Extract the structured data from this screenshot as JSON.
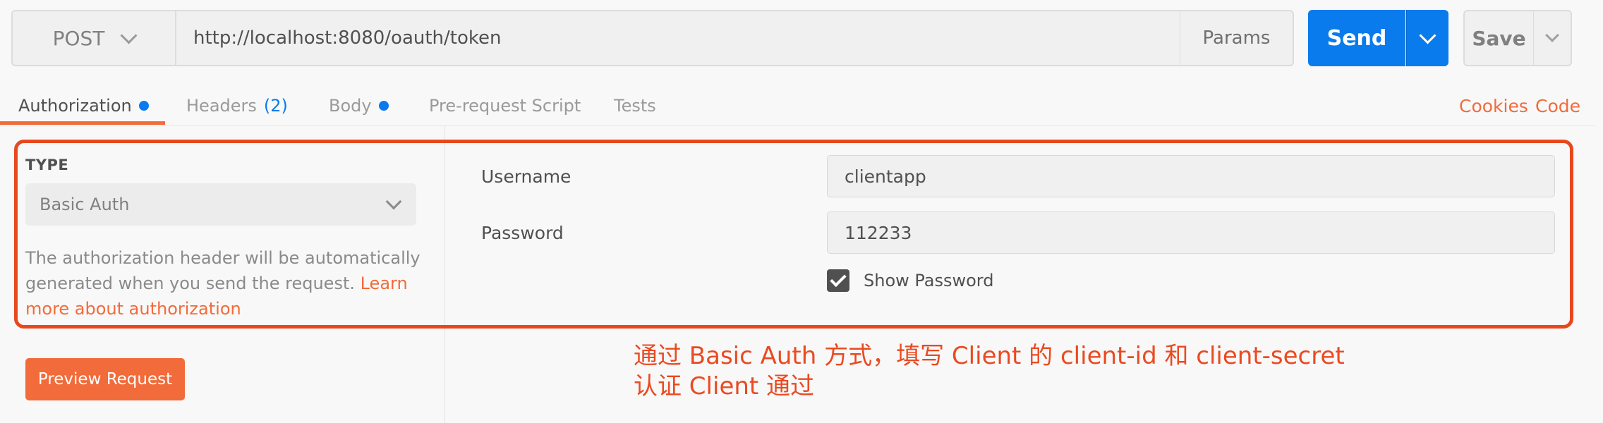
{
  "request": {
    "method": "POST",
    "url": "http://localhost:8080/oauth/token",
    "params_label": "Params",
    "send_label": "Send",
    "save_label": "Save"
  },
  "tabs": [
    {
      "label": "Authorization",
      "active": true,
      "dot": true
    },
    {
      "label": "Headers",
      "count": "(2)"
    },
    {
      "label": "Body",
      "dot": true
    },
    {
      "label": "Pre-request Script"
    },
    {
      "label": "Tests"
    }
  ],
  "links": {
    "cookies": "Cookies",
    "code": "Code"
  },
  "auth": {
    "type_label": "TYPE",
    "type_value": "Basic Auth",
    "description": "The authorization header will be automatically generated when you send the request. ",
    "learn_more": "Learn more about authorization",
    "preview_button": "Preview Request",
    "username_label": "Username",
    "username_value": "clientapp",
    "password_label": "Password",
    "password_value": "112233",
    "show_password_label": "Show Password",
    "show_password_checked": true
  },
  "annotation": {
    "line1": "通过 Basic Auth 方式，填写 Client 的 client-id 和 client-secret",
    "line2": "认证 Client 通过"
  },
  "colors": {
    "accent_orange": "#f26b3a",
    "send_blue": "#097bed",
    "annotation_red": "#e8481e"
  }
}
